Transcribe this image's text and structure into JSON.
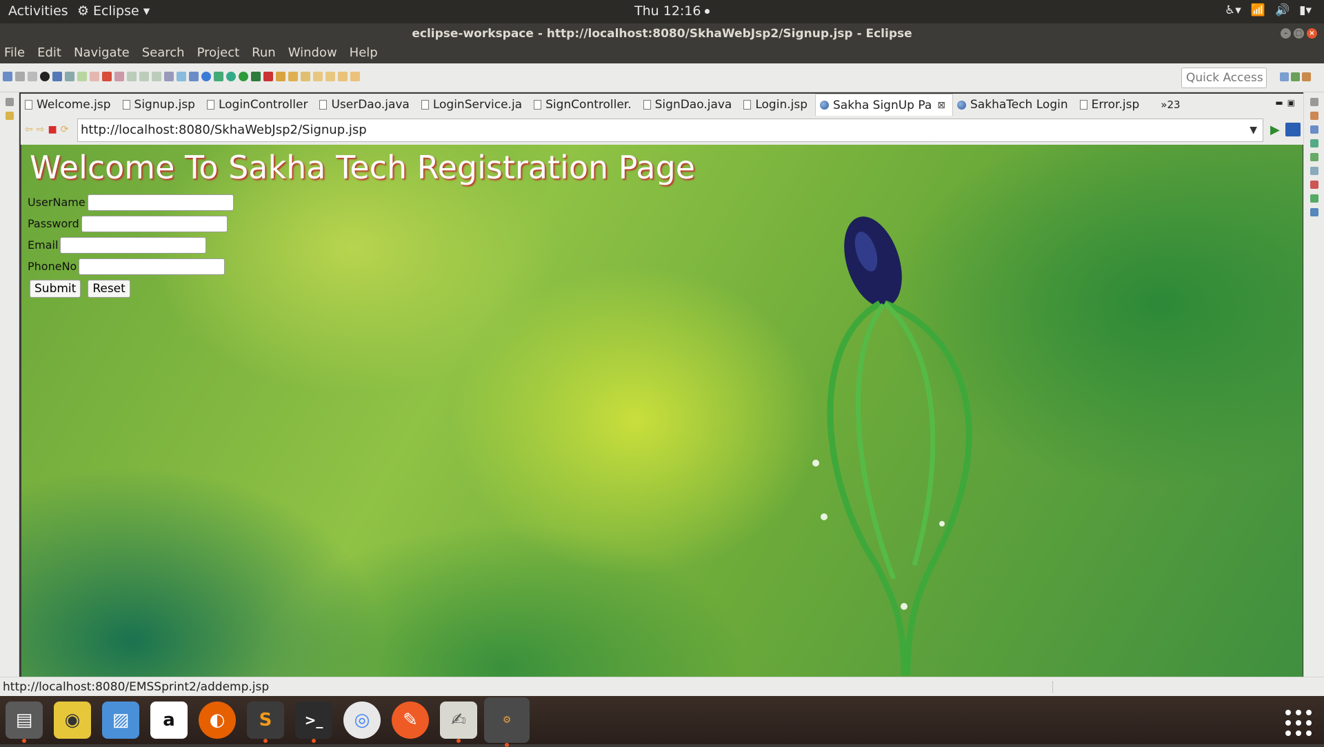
{
  "topbar": {
    "activities": "Activities",
    "app": "Eclipse",
    "clock": "Thu 12:16"
  },
  "window": {
    "title": "eclipse-workspace - http://localhost:8080/SkhaWebJsp2/Signup.jsp - Eclipse"
  },
  "menu": [
    "File",
    "Edit",
    "Navigate",
    "Search",
    "Project",
    "Run",
    "Window",
    "Help"
  ],
  "toolbar": {
    "quick_access": "Quick Access"
  },
  "tabs": [
    {
      "label": "Welcome.jsp",
      "icon": "file"
    },
    {
      "label": "Signup.jsp",
      "icon": "file"
    },
    {
      "label": "LoginController",
      "icon": "file"
    },
    {
      "label": "UserDao.java",
      "icon": "file"
    },
    {
      "label": "LoginService.ja",
      "icon": "file"
    },
    {
      "label": "SignController.",
      "icon": "file"
    },
    {
      "label": "SignDao.java",
      "icon": "file"
    },
    {
      "label": "Login.jsp",
      "icon": "file"
    },
    {
      "label": "Sakha SignUp Pa",
      "icon": "globe",
      "active": true
    },
    {
      "label": "SakhaTech Login",
      "icon": "globe"
    },
    {
      "label": "Error.jsp",
      "icon": "file"
    }
  ],
  "tabs_overflow": "»23",
  "browser": {
    "url": "http://localhost:8080/SkhaWebJsp2/Signup.jsp"
  },
  "page": {
    "heading": "Welcome To Sakha Tech Registration Page",
    "fields": {
      "username": {
        "label": "UserName",
        "value": ""
      },
      "password": {
        "label": "Password",
        "value": ""
      },
      "email": {
        "label": "Email",
        "value": ""
      },
      "phone": {
        "label": "PhoneNo",
        "value": ""
      }
    },
    "submit": "Submit",
    "reset": "Reset"
  },
  "status": {
    "text": "http://localhost:8080/EMSSprint2/addemp.jsp"
  },
  "dock": [
    {
      "name": "files",
      "color": "#5a5a5a",
      "running": true
    },
    {
      "name": "rhythmbox",
      "color": "#e6c73a",
      "running": false
    },
    {
      "name": "image-viewer",
      "color": "#4a90d9",
      "running": false
    },
    {
      "name": "amazon",
      "color": "#ffffff",
      "running": false
    },
    {
      "name": "firefox",
      "color": "#e66000",
      "running": false
    },
    {
      "name": "sublime-text",
      "color": "#3b3b3b",
      "running": true
    },
    {
      "name": "terminal",
      "color": "#2c2c2c",
      "running": true
    },
    {
      "name": "chrome",
      "color": "#e8e8e8",
      "running": false
    },
    {
      "name": "postman",
      "color": "#ef5b25",
      "running": false
    },
    {
      "name": "text-editor",
      "color": "#d8d8d0",
      "running": true
    },
    {
      "name": "eclipse-javaee",
      "color": "#4a4a4a",
      "running": true
    }
  ]
}
